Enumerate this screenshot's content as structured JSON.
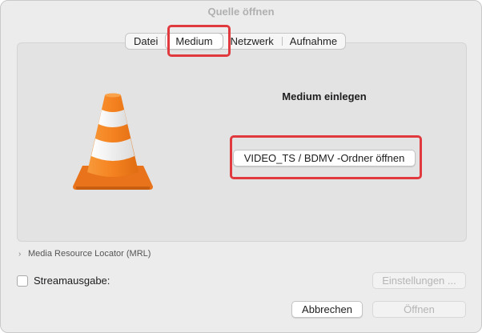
{
  "window": {
    "title": "Quelle öffnen"
  },
  "tabs": [
    {
      "label": "Datei",
      "active": false
    },
    {
      "label": "Medium",
      "active": true
    },
    {
      "label": "Netzwerk",
      "active": false
    },
    {
      "label": "Aufnahme",
      "active": false
    }
  ],
  "disc": {
    "heading": "Medium einlegen",
    "open_folder_label": "VIDEO_TS / BDMV -Ordner öffnen"
  },
  "mrl": {
    "label": "Media Resource Locator (MRL)"
  },
  "stream_output": {
    "label": "Streamausgabe:",
    "checked": false
  },
  "buttons": {
    "settings": "Einstellungen ...",
    "cancel": "Abbrechen",
    "open": "Öffnen"
  },
  "colors": {
    "cone_orange": "#f58220",
    "cone_stripe": "#ffffff",
    "highlight_red": "#e0393e"
  },
  "icons": {
    "logo": "vlc-cone-icon",
    "disclosure": "chevron-right-icon"
  }
}
